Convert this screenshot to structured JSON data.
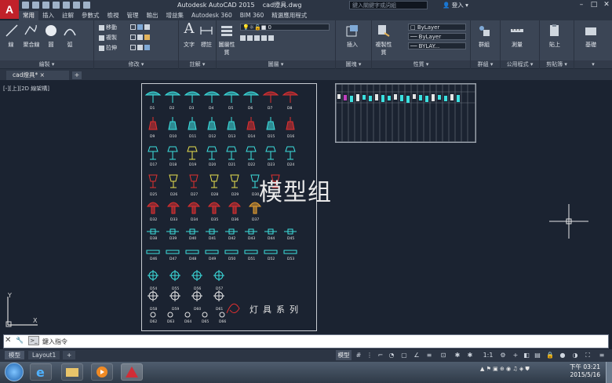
{
  "app": {
    "logo": "A",
    "title": "Autodesk AutoCAD 2015    cad燈具.dwg",
    "search_placeholder": "鍵入關鍵字或詞組",
    "user": "登入"
  },
  "qat_icons": [
    "new-icon",
    "open-icon",
    "save-icon",
    "saveas-icon",
    "print-icon",
    "undo-icon",
    "redo-icon"
  ],
  "ribbon_tabs": [
    "常用",
    "插入",
    "註解",
    "參數式",
    "檢視",
    "管理",
    "輸出",
    "增益集",
    "Autodesk 360",
    "BIM 360",
    "精選應用程式"
  ],
  "ribbon": {
    "draw": {
      "label": "繪製",
      "line": "線",
      "polyline": "聚合線",
      "circle": "圓",
      "arc": "弧"
    },
    "modify": {
      "label": "修改",
      "move": "移動",
      "copy": "複製",
      "stretch": "拉伸"
    },
    "annotation": {
      "label": "註解",
      "text": "文字",
      "dimension": "標註"
    },
    "layers": {
      "label": "圖層",
      "properties": "圖層性質",
      "current": "0"
    },
    "block": {
      "label": "圖塊",
      "insert": "插入"
    },
    "properties": {
      "label": "性質",
      "match": "複製性質",
      "color": "ByLayer",
      "linetype": "ByLayer",
      "lineweight": "BYLAY..."
    },
    "groups": {
      "label": "群組",
      "group": "群組"
    },
    "utilities": {
      "label": "公用程式",
      "measure": "測量"
    },
    "clipboard": {
      "label": "剪貼簿",
      "paste": "貼上"
    },
    "view": {
      "label": "",
      "base": "基礎"
    }
  },
  "file_tab": "cad燈具*",
  "viewport_label": "[-][上][2D 線架構]",
  "watermark": "模型组",
  "sheet_title": "灯具系列",
  "fixture_codes": [
    "D1",
    "D2",
    "D3",
    "D4",
    "D5",
    "D6",
    "D7",
    "D8",
    "D9",
    "D10",
    "D11",
    "D12",
    "D13",
    "D14",
    "D15",
    "D16",
    "D17",
    "D18",
    "D19",
    "D20",
    "D21",
    "D22",
    "D23",
    "D24",
    "D25",
    "D26",
    "D27",
    "D28",
    "D29",
    "D30",
    "D31",
    "D32",
    "D33",
    "D34",
    "D35",
    "D36",
    "D37",
    "D38",
    "D39",
    "D40",
    "D41",
    "D42",
    "D43",
    "D44",
    "D45",
    "D46",
    "D47",
    "D48",
    "D49",
    "D50",
    "D51",
    "D52",
    "D53",
    "D54",
    "D55",
    "D56",
    "D57",
    "D58",
    "D59",
    "D60",
    "D61",
    "D62",
    "D63",
    "D64",
    "D65",
    "D66",
    "D67",
    "D68",
    "D69",
    "D70",
    "D71",
    "D72",
    "D73",
    "D74",
    "D75",
    "D76"
  ],
  "command": {
    "placeholder": "鍵入指令"
  },
  "layout_tabs": [
    "模型",
    "Layout1",
    "+"
  ],
  "status": {
    "model": "模型",
    "scale": "1:1"
  },
  "taskbar": {
    "time": "下午 03:21",
    "date": "2015/5/16"
  }
}
